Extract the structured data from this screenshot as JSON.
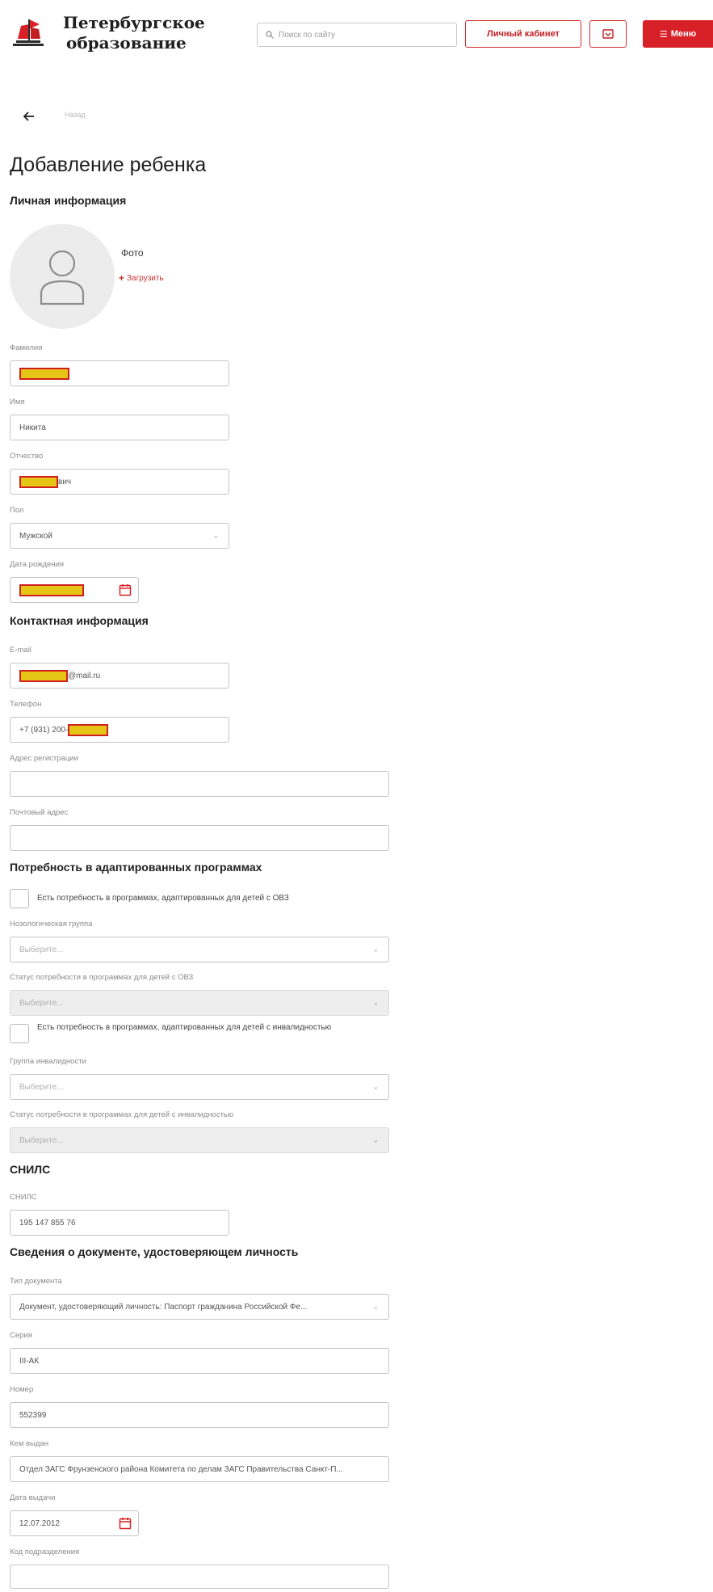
{
  "header": {
    "logo_line1": "Петербургское",
    "logo_line2": "образование",
    "search_placeholder": "Поиск по сайту",
    "cabinet_label": "Личный кабинет",
    "menu_label": "Меню"
  },
  "breadcrumb": "Назад",
  "page_title": "Добавление ребенка",
  "personal": {
    "title": "Личная информация",
    "photo_label": "Фото",
    "upload_label": "Загрузить",
    "surname_label": "Фамилия",
    "name_label": "Имя",
    "name_value": "Никита",
    "patronymic_label": "Отчество",
    "patronymic_suffix": "вич",
    "gender_label": "Пол",
    "gender_value": "Мужской",
    "birth_label": "Дата рождения"
  },
  "contact": {
    "title": "Контактная информация",
    "email_label": "E-mail",
    "email_suffix": "@mail.ru",
    "phone_label": "Телефон",
    "phone_prefix": "+7 (931) 200-",
    "reg_address_label": "Адрес регистрации",
    "post_address_label": "Почтовый адрес"
  },
  "adapted": {
    "title": "Потребность в адаптированных программах",
    "ovz_checkbox": "Есть потребность в программах, адаптированных для детей с ОВЗ",
    "nosology_label": "Нозологическая группа",
    "select_placeholder": "Выберите...",
    "ovz_status_label": "Статус потребности в программах для детей с ОВЗ",
    "disability_checkbox": "Есть потребность в программах, адаптированных для детей с инвалидностью",
    "disability_group_label": "Группа инвалидности",
    "disability_status_label": "Статус потребности в программах для детей с инвалидностью"
  },
  "snils": {
    "title": "СНИЛС",
    "label": "СНИЛС",
    "value": "195 147 855 76"
  },
  "document": {
    "title": "Сведения о документе, удостоверяющем личность",
    "type_label": "Тип документа",
    "type_value": "Документ, удостоверяющий личность: Паспорт гражданина Российской Фе...",
    "series_label": "Серия",
    "series_value": "III-АК",
    "number_label": "Номер",
    "number_value": "552399",
    "issuer_label": "Кем выдан",
    "issuer_value": "Отдел ЗАГС Фрунзенского района Комитета по делам ЗАГС Правительства Санкт-П...",
    "issue_date_label": "Дата выдачи",
    "issue_date_value": "12.07.2012",
    "dept_code_label": "Код подразделения"
  },
  "colors": {
    "brand_red": "#d72027",
    "redaction_fill": "#e5c617",
    "redaction_border": "#d11f1f"
  }
}
